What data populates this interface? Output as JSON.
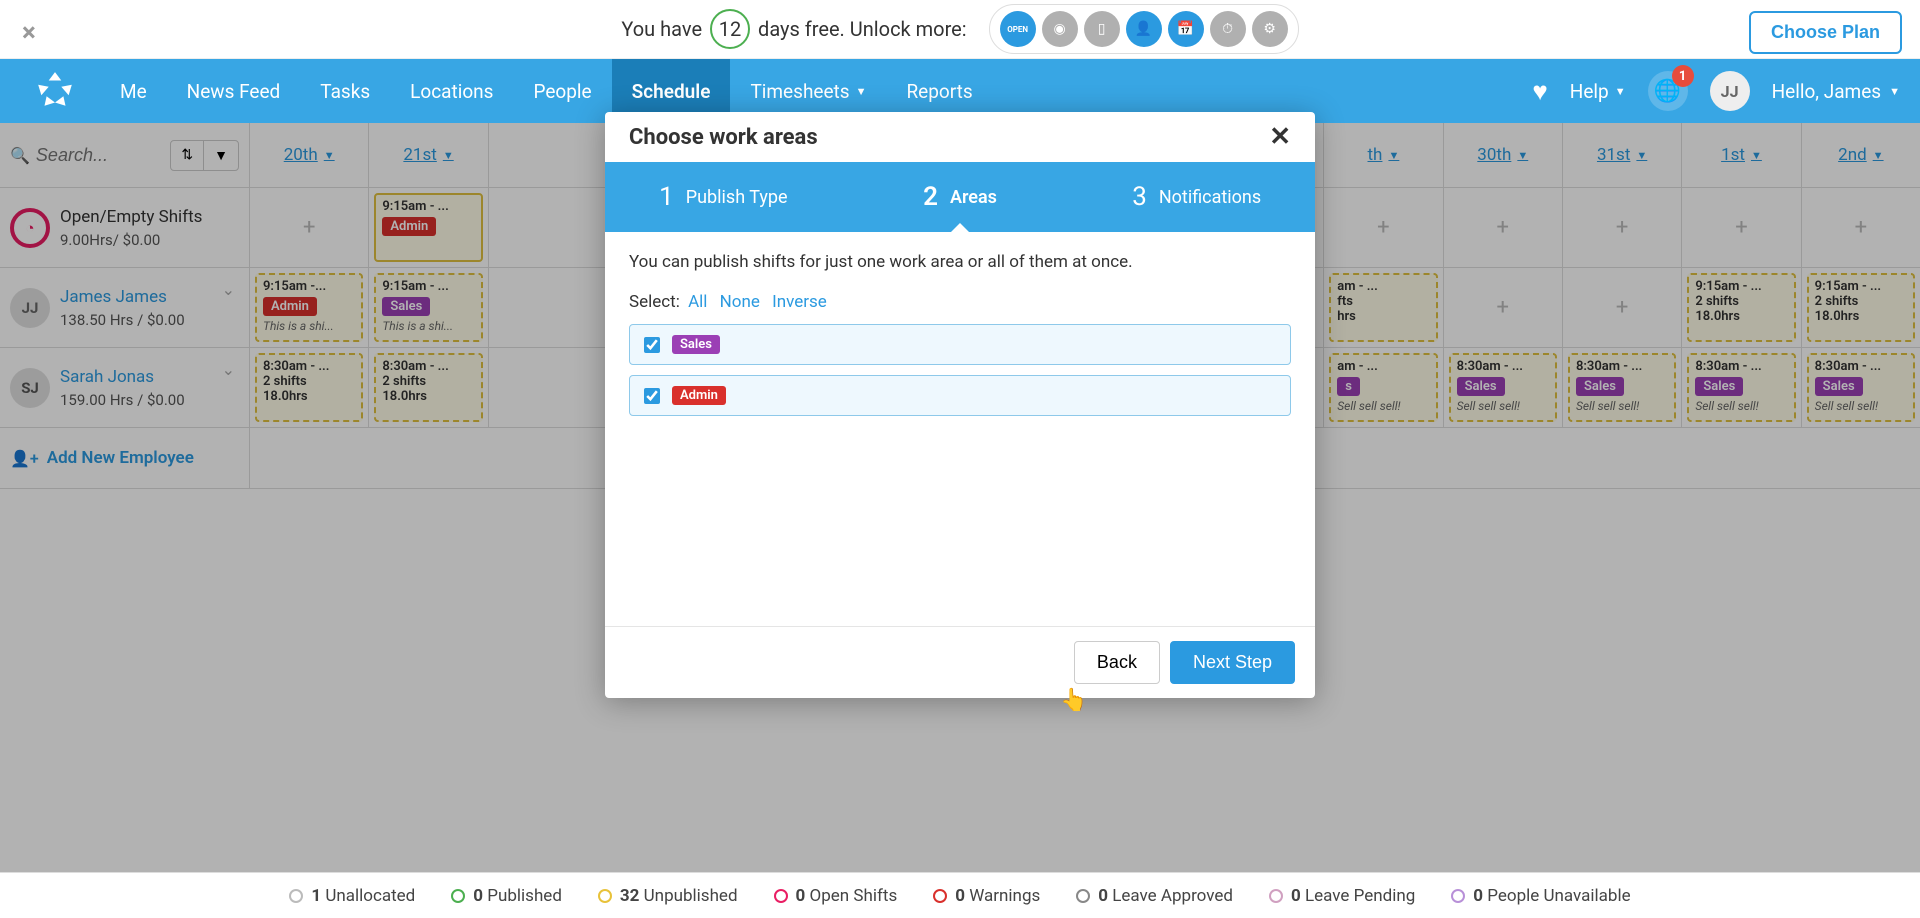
{
  "banner": {
    "prefix": "You have",
    "days": "12",
    "suffix": "days free. Unlock more:",
    "choose_plan": "Choose Plan"
  },
  "nav": {
    "items": [
      "Me",
      "News Feed",
      "Tasks",
      "Locations",
      "People",
      "Schedule",
      "Timesheets",
      "Reports"
    ],
    "active": "Schedule",
    "help": "Help",
    "notif_count": "1",
    "avatar": "JJ",
    "hello": "Hello, James"
  },
  "toolbar": {
    "search_placeholder": "Search...",
    "dates": [
      "20th",
      "21st",
      "",
      "",
      "",
      "",
      "",
      "",
      "",
      "th",
      "30th",
      "31st",
      "1st",
      "2nd"
    ]
  },
  "rows": {
    "open": {
      "name": "Open/Empty Shifts",
      "sub": "9.00Hrs/ $0.00"
    },
    "james": {
      "avatar": "JJ",
      "name": "James James",
      "sub": "138.50 Hrs / $0.00"
    },
    "sarah": {
      "avatar": "SJ",
      "name": "Sarah Jonas",
      "sub": "159.00 Hrs / $0.00"
    }
  },
  "shifts": {
    "t915": "9:15am - ...",
    "t915s": "9:15am -...",
    "t830": "8:30am - ...",
    "note_this": "This is a shi...",
    "note_sell": "Sell sell sell!",
    "two_shifts": "2 shifts",
    "hrs18": "18.0hrs",
    "admin_tag": "Admin",
    "sales_tag": "Sales"
  },
  "add_employee": "Add New Employee",
  "status": [
    {
      "count": "1",
      "label": "Unallocated",
      "color": "#bbb"
    },
    {
      "count": "0",
      "label": "Published",
      "color": "#4CAF50"
    },
    {
      "count": "32",
      "label": "Unpublished",
      "color": "#e8c23a"
    },
    {
      "count": "0",
      "label": "Open Shifts",
      "color": "#e91e63"
    },
    {
      "count": "0",
      "label": "Warnings",
      "color": "#d9302c"
    },
    {
      "count": "0",
      "label": "Leave Approved",
      "color": "#888"
    },
    {
      "count": "0",
      "label": "Leave Pending",
      "color": "#d0a0c0"
    },
    {
      "count": "0",
      "label": "People Unavailable",
      "color": "#b890d8"
    }
  ],
  "modal": {
    "title": "Choose work areas",
    "steps": [
      {
        "num": "1",
        "label": "Publish Type"
      },
      {
        "num": "2",
        "label": "Areas"
      },
      {
        "num": "3",
        "label": "Notifications"
      }
    ],
    "hint": "You can publish shifts for just one work area or all of them at once.",
    "select_label": "Select:",
    "select_all": "All",
    "select_none": "None",
    "select_inverse": "Inverse",
    "areas": [
      {
        "name": "Sales",
        "class": "sales",
        "checked": true
      },
      {
        "name": "Admin",
        "class": "admin",
        "checked": true
      }
    ],
    "back": "Back",
    "next": "Next Step"
  }
}
